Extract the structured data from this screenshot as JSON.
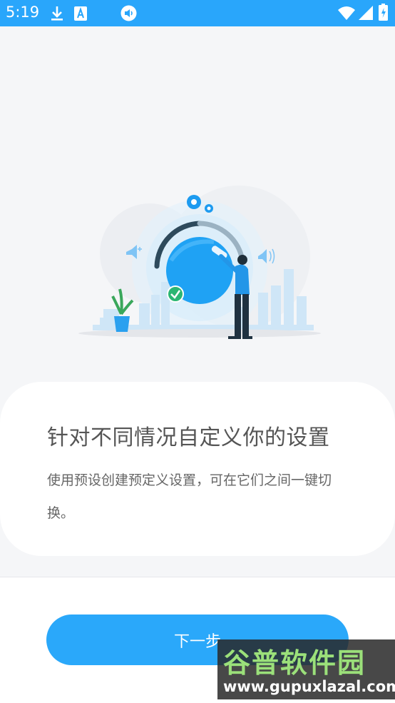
{
  "status_bar": {
    "time": "5:19",
    "icons_left": [
      "download-icon",
      "a-font-icon",
      "volume-icon"
    ],
    "icons_right": [
      "wifi-icon",
      "signal-icon",
      "battery-icon"
    ],
    "background": "#29a6fb"
  },
  "illustration": {
    "name": "volume-knob-illustration"
  },
  "card": {
    "title": "针对不同情况自定义你的设置",
    "description": "使用预设创建预定义设置，可在它们之间一键切换。"
  },
  "actions": {
    "next_label": "下一步",
    "accent": "#2aa8fa"
  },
  "watermark": {
    "text": "谷普软件园",
    "url": "www.gupuxlazal.com"
  }
}
